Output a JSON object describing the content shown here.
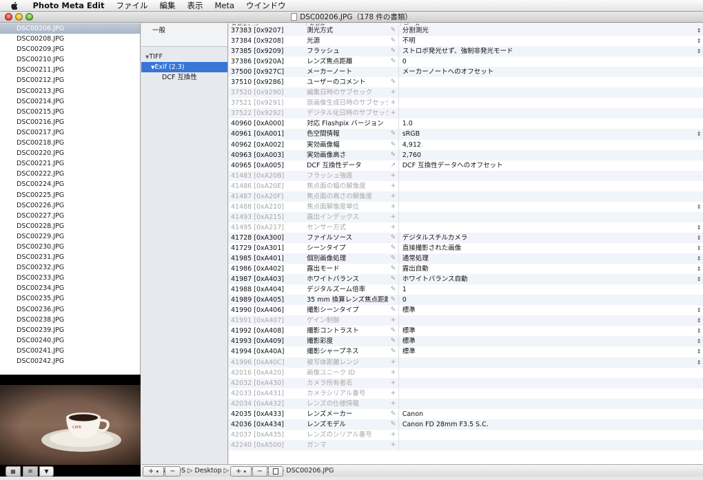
{
  "menubar": {
    "app_name": "Photo Meta Edit",
    "items": [
      "ファイル",
      "編集",
      "表示",
      "Meta",
      "ウインドウ"
    ]
  },
  "window": {
    "title": "DSC00206.JPG（178 件の書類）"
  },
  "files": [
    "DSC00206.JPG",
    "DSC00208.JPG",
    "DSC00209.JPG",
    "DSC00210.JPG",
    "DSC00211.JPG",
    "DSC00212.JPG",
    "DSC00213.JPG",
    "DSC00214.JPG",
    "DSC00215.JPG",
    "DSC00216.JPG",
    "DSC00217.JPG",
    "DSC00218.JPG",
    "DSC00220.JPG",
    "DSC00221.JPG",
    "DSC00222.JPG",
    "DSC00224.JPG",
    "DSC00225.JPG",
    "DSC00226.JPG",
    "DSC00227.JPG",
    "DSC00228.JPG",
    "DSC00229.JPG",
    "DSC00230.JPG",
    "DSC00231.JPG",
    "DSC00232.JPG",
    "DSC00233.JPG",
    "DSC00234.JPG",
    "DSC00235.JPG",
    "DSC00236.JPG",
    "DSC00238.JPG",
    "DSC00239.JPG",
    "DSC00240.JPG",
    "DSC00241.JPG",
    "DSC00242.JPG"
  ],
  "tree": {
    "general": "一般",
    "tiff": "TIFF",
    "exif": "Exif (2.3)",
    "dcf": "DCF 互換性"
  },
  "table": {
    "headers": [
      "タグナンバー",
      "タグ名",
      "データ"
    ],
    "rows": [
      {
        "num": "37383 [0x9207]",
        "name": "測光方式",
        "icon": "✎",
        "data": "分割測光",
        "dim": false,
        "popup": true
      },
      {
        "num": "37384 [0x9208]",
        "name": "光源",
        "icon": "✎",
        "data": "不明",
        "dim": false,
        "popup": true
      },
      {
        "num": "37385 [0x9209]",
        "name": "フラッシュ",
        "icon": "✎",
        "data": "ストロボ発光せず、強制非発光モード",
        "dim": false,
        "popup": true
      },
      {
        "num": "37386 [0x920A]",
        "name": "レンズ焦点距離",
        "icon": "✎",
        "data": "0",
        "dim": false,
        "popup": false
      },
      {
        "num": "37500 [0x927C]",
        "name": "メーカーノート",
        "icon": "",
        "data": "メーカーノートへのオフセット",
        "dim": false,
        "popup": false
      },
      {
        "num": "37510 [0x9286]",
        "name": "ユーザーのコメント",
        "icon": "✎",
        "data": "",
        "dim": false,
        "popup": false
      },
      {
        "num": "37520 [0x9290]",
        "name": "編集日時のサブセック",
        "icon": "+",
        "data": "",
        "dim": true,
        "popup": false
      },
      {
        "num": "37521 [0x9291]",
        "name": "原画像生成日時のサブセック",
        "icon": "+",
        "data": "",
        "dim": true,
        "popup": false
      },
      {
        "num": "37522 [0x9292]",
        "name": "デジタル化日時のサブセック",
        "icon": "+",
        "data": "",
        "dim": true,
        "popup": false
      },
      {
        "num": "40960 [0xA000]",
        "name": "対応 Flashpix バージョン",
        "icon": "",
        "data": "1.0",
        "dim": false,
        "popup": false
      },
      {
        "num": "40961 [0xA001]",
        "name": "色空間情報",
        "icon": "✎",
        "data": "sRGB",
        "dim": false,
        "popup": true
      },
      {
        "num": "40962 [0xA002]",
        "name": "実効画像幅",
        "icon": "✎",
        "data": "4,912",
        "dim": false,
        "popup": false
      },
      {
        "num": "40963 [0xA003]",
        "name": "実効画像高さ",
        "icon": "✎",
        "data": "2,760",
        "dim": false,
        "popup": false
      },
      {
        "num": "40965 [0xA005]",
        "name": "DCF 互換性データ",
        "icon": "↗",
        "data": "DCF 互換性データへのオフセット",
        "dim": false,
        "popup": false
      },
      {
        "num": "41483 [0xA20B]",
        "name": "フラッシュ強度",
        "icon": "+",
        "data": "",
        "dim": true,
        "popup": false
      },
      {
        "num": "41486 [0xA20E]",
        "name": "焦点面の幅の解像度",
        "icon": "+",
        "data": "",
        "dim": true,
        "popup": false
      },
      {
        "num": "41487 [0xA20F]",
        "name": "焦点面の高さの解像度",
        "icon": "+",
        "data": "",
        "dim": true,
        "popup": false
      },
      {
        "num": "41488 [0xA210]",
        "name": "焦点面解像度単位",
        "icon": "+",
        "data": "",
        "dim": true,
        "popup": true
      },
      {
        "num": "41493 [0xA215]",
        "name": "露出インデックス",
        "icon": "+",
        "data": "",
        "dim": true,
        "popup": false
      },
      {
        "num": "41495 [0xA217]",
        "name": "センサー方式",
        "icon": "+",
        "data": "",
        "dim": true,
        "popup": true
      },
      {
        "num": "41728 [0xA300]",
        "name": "ファイルソース",
        "icon": "✎",
        "data": "デジタルスチルカメラ",
        "dim": false,
        "popup": true
      },
      {
        "num": "41729 [0xA301]",
        "name": "シーンタイプ",
        "icon": "✎",
        "data": "直接撮影された画像",
        "dim": false,
        "popup": true
      },
      {
        "num": "41985 [0xA401]",
        "name": "個別画像処理",
        "icon": "✎",
        "data": "通常処理",
        "dim": false,
        "popup": true
      },
      {
        "num": "41986 [0xA402]",
        "name": "露出モード",
        "icon": "✎",
        "data": "露出自動",
        "dim": false,
        "popup": true
      },
      {
        "num": "41987 [0xA403]",
        "name": "ホワイトバランス",
        "icon": "✎",
        "data": "ホワイトバランス自動",
        "dim": false,
        "popup": true
      },
      {
        "num": "41988 [0xA404]",
        "name": "デジタルズーム倍率",
        "icon": "✎",
        "data": "1",
        "dim": false,
        "popup": false
      },
      {
        "num": "41989 [0xA405]",
        "name": "35 mm 換算レンズ焦点距離",
        "icon": "✎",
        "data": "0",
        "dim": false,
        "popup": false
      },
      {
        "num": "41990 [0xA406]",
        "name": "撮影シーンタイプ",
        "icon": "✎",
        "data": "標準",
        "dim": false,
        "popup": true
      },
      {
        "num": "41991 [0xA407]",
        "name": "ゲイン制御",
        "icon": "+",
        "data": "",
        "dim": true,
        "popup": true
      },
      {
        "num": "41992 [0xA408]",
        "name": "撮影コントラスト",
        "icon": "✎",
        "data": "標準",
        "dim": false,
        "popup": true
      },
      {
        "num": "41993 [0xA409]",
        "name": "撮影彩度",
        "icon": "✎",
        "data": "標準",
        "dim": false,
        "popup": true
      },
      {
        "num": "41994 [0xA40A]",
        "name": "撮影シャープネス",
        "icon": "✎",
        "data": "標準",
        "dim": false,
        "popup": true
      },
      {
        "num": "41996 [0xA40C]",
        "name": "被写体距離レンジ",
        "icon": "+",
        "data": "",
        "dim": true,
        "popup": true
      },
      {
        "num": "42016 [0xA420]",
        "name": "画像ユニーク ID",
        "icon": "+",
        "data": "",
        "dim": true,
        "popup": false
      },
      {
        "num": "42032 [0xA430]",
        "name": "カメラ所有者名",
        "icon": "+",
        "data": "",
        "dim": true,
        "popup": false
      },
      {
        "num": "42033 [0xA431]",
        "name": "カメラシリアル番号",
        "icon": "+",
        "data": "",
        "dim": true,
        "popup": false
      },
      {
        "num": "42034 [0xA432]",
        "name": "レンズの仕様情報",
        "icon": "+",
        "data": "",
        "dim": true,
        "popup": false
      },
      {
        "num": "42035 [0xA433]",
        "name": "レンズメーカー",
        "icon": "✎",
        "data": "Canon",
        "dim": false,
        "popup": false
      },
      {
        "num": "42036 [0xA434]",
        "name": "レンズモデル",
        "icon": "✎",
        "data": "Canon FD 28mm F3.5 S.C.",
        "dim": false,
        "popup": false
      },
      {
        "num": "42037 [0xA435]",
        "name": "レンズのシリアル番号",
        "icon": "+",
        "data": "",
        "dim": true,
        "popup": false
      },
      {
        "num": "42240 [0xA500]",
        "name": "ガンマ",
        "icon": "+",
        "data": "",
        "dim": true,
        "popup": false
      }
    ]
  },
  "pathbar": {
    "path": "Users ▷ iOS ▷ Desktop ▷ FD28mm F3.5 ▷ DSC00206.JPG"
  },
  "buttons": {
    "add": "+",
    "remove": "−",
    "dropdown": "▾"
  }
}
